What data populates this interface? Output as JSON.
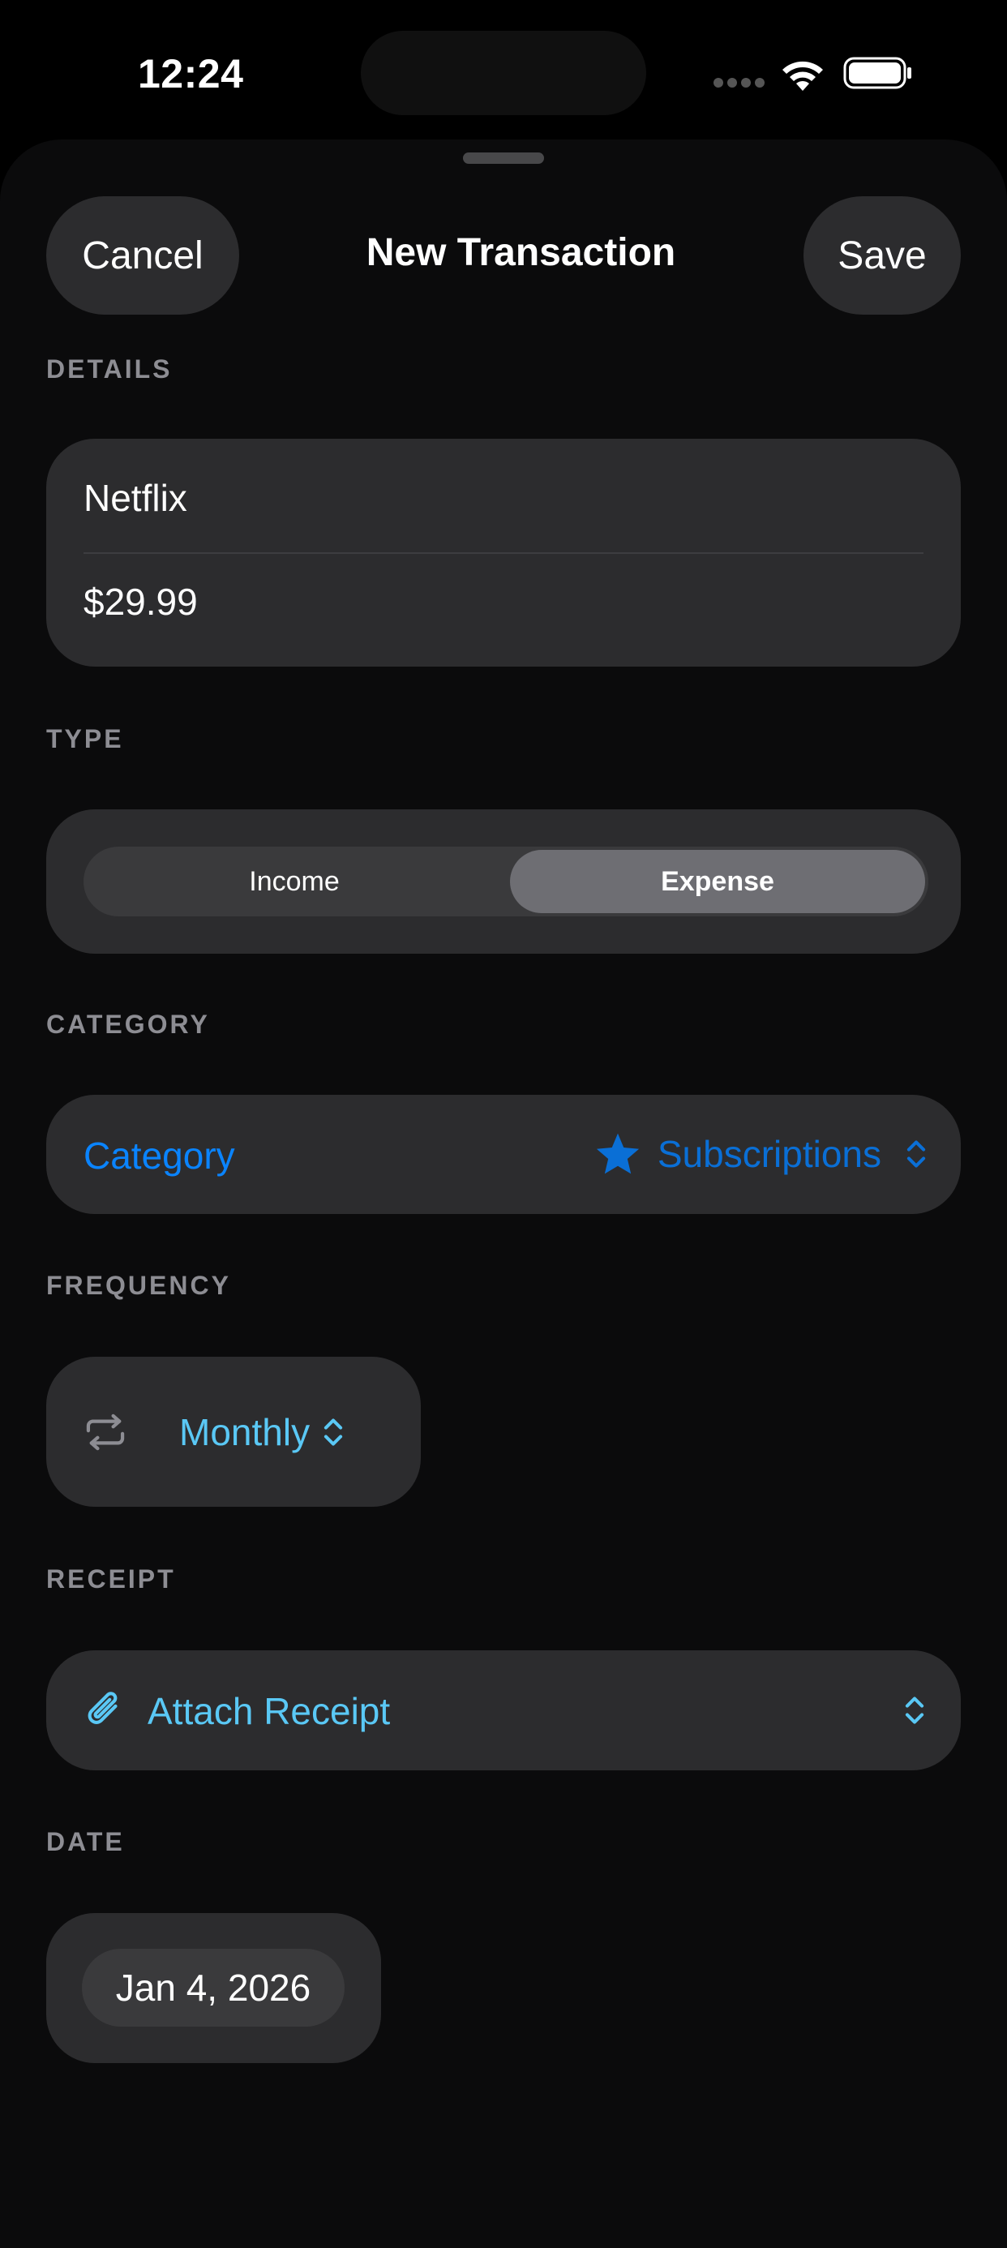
{
  "status_bar": {
    "time": "12:24"
  },
  "nav": {
    "cancel_label": "Cancel",
    "title": "New Transaction",
    "save_label": "Save"
  },
  "details": {
    "header": "DETAILS",
    "name_value": "Netflix",
    "amount_value": "$29.99"
  },
  "type": {
    "header": "TYPE",
    "options": [
      "Income",
      "Expense"
    ],
    "selected": "Expense"
  },
  "category": {
    "header": "CATEGORY",
    "label": "Category",
    "value": "Subscriptions",
    "icon": "star-icon"
  },
  "frequency": {
    "header": "FREQUENCY",
    "value": "Monthly",
    "icon": "repeat-icon"
  },
  "receipt": {
    "header": "RECEIPT",
    "label": "Attach Receipt",
    "icon": "paperclip-icon"
  },
  "date": {
    "header": "DATE",
    "value": "Jan 4, 2026"
  },
  "colors": {
    "background": "#000000",
    "card": "#2c2c2e",
    "accent_blue": "#0a84ff",
    "accent_cyan": "#5ac8f5",
    "secondary_text": "#8d8d93"
  }
}
